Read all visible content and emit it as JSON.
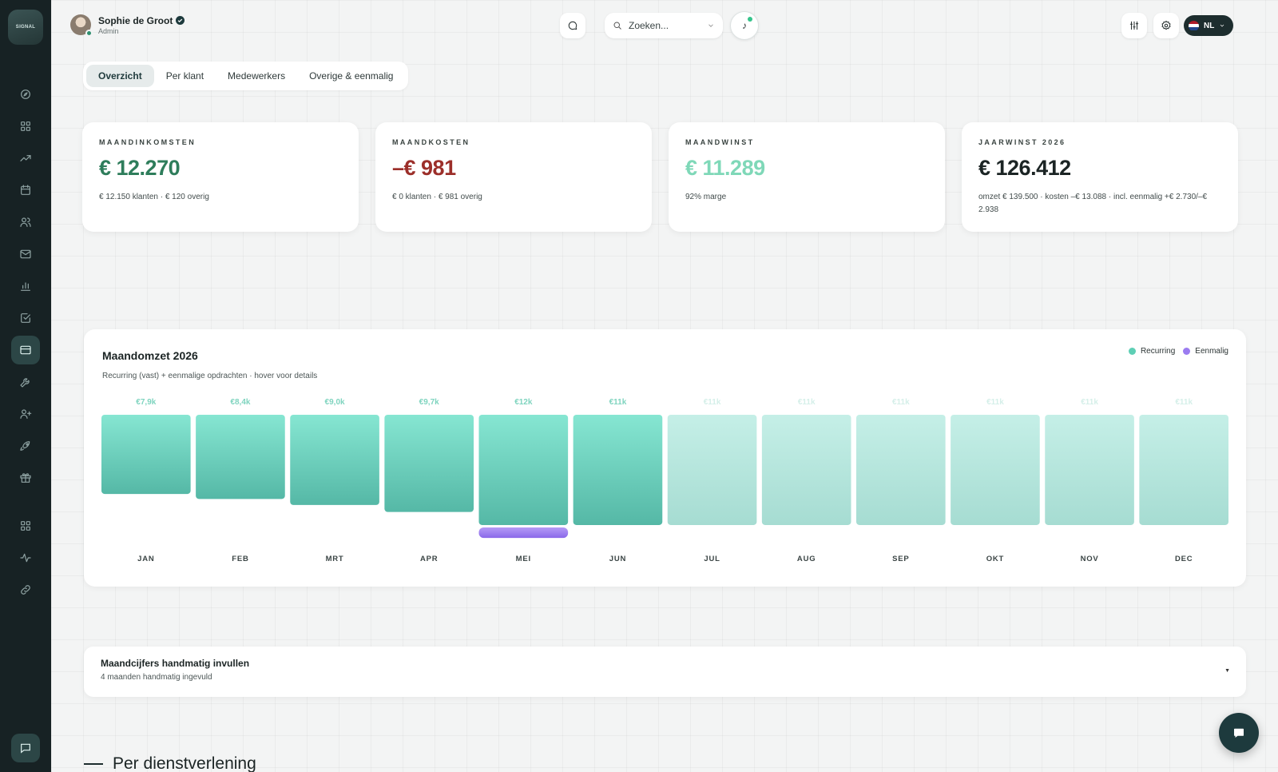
{
  "sidebar": {
    "logo_text": "SIGNAL",
    "items": [
      {
        "icon": "compass-icon",
        "name": "sidebar-item-explore"
      },
      {
        "icon": "grid-icon",
        "name": "sidebar-item-dashboard"
      },
      {
        "icon": "trending-up-icon",
        "name": "sidebar-item-trends"
      },
      {
        "icon": "calendar-icon",
        "name": "sidebar-item-calendar"
      },
      {
        "icon": "users-icon",
        "name": "sidebar-item-team"
      },
      {
        "icon": "mail-icon",
        "name": "sidebar-item-mail"
      },
      {
        "icon": "bar-chart-icon",
        "name": "sidebar-item-reports"
      },
      {
        "icon": "checkbox-icon",
        "name": "sidebar-item-tasks"
      },
      {
        "icon": "credit-card-icon",
        "name": "sidebar-item-finance",
        "active": true
      },
      {
        "icon": "wrench-icon",
        "name": "sidebar-item-tools"
      },
      {
        "icon": "user-plus-icon",
        "name": "sidebar-item-add-user"
      },
      {
        "icon": "rocket-icon",
        "name": "sidebar-item-launch"
      },
      {
        "icon": "gift-icon",
        "name": "sidebar-item-gifts"
      }
    ],
    "items_bottom": [
      {
        "icon": "apps-icon",
        "name": "sidebar-item-apps"
      },
      {
        "icon": "activity-icon",
        "name": "sidebar-item-activity"
      },
      {
        "icon": "link-icon",
        "name": "sidebar-item-links"
      }
    ]
  },
  "header": {
    "user_name": "Sophie de Groot",
    "user_role": "Admin",
    "search_placeholder": "Zoeken...",
    "language": "NL"
  },
  "tabs": [
    {
      "label": "Overzicht",
      "active": true
    },
    {
      "label": "Per klant",
      "active": false
    },
    {
      "label": "Medewerkers",
      "active": false
    },
    {
      "label": "Overige & eenmalig",
      "active": false
    }
  ],
  "cards": [
    {
      "label": "MAANDINKOMSTEN",
      "value": "€ 12.270",
      "sub": "€ 12.150 klanten · € 120 overig",
      "color": "#2e7d5b"
    },
    {
      "label": "MAANDKOSTEN",
      "value": "–€ 981",
      "sub": "€ 0 klanten · € 981 overig",
      "color": "#9c2f2a"
    },
    {
      "label": "MAANDWINST",
      "value": "€ 11.289",
      "sub": "92% marge",
      "color": "#7fd8b8"
    },
    {
      "label": "JAARWINST 2026",
      "value": "€ 126.412",
      "sub": "omzet € 139.500 · kosten –€ 13.088 · incl. eenmalig +€ 2.730/–€ 2.938",
      "color": "#1b2424"
    }
  ],
  "chart": {
    "title": "Maandomzet 2026",
    "subtitle": "Recurring (vast) + eenmalige opdrachten · hover voor details",
    "legend": [
      {
        "label": "Recurring",
        "color": "#5ecfb5"
      },
      {
        "label": "Eenmalig",
        "color": "#9b7cf0"
      }
    ]
  },
  "chart_data": {
    "type": "bar",
    "categories": [
      "JAN",
      "FEB",
      "MRT",
      "APR",
      "MEI",
      "JUN",
      "JUL",
      "AUG",
      "SEP",
      "OKT",
      "NOV",
      "DEC"
    ],
    "series": [
      {
        "name": "Recurring",
        "values": [
          7.9,
          8.4,
          9.0,
          9.7,
          11.0,
          11.0,
          11.0,
          11.0,
          11.0,
          11.0,
          11.0,
          11.0
        ]
      },
      {
        "name": "Eenmalig",
        "values": [
          0,
          0,
          0,
          0,
          1.0,
          0,
          0,
          0,
          0,
          0,
          0,
          0
        ]
      }
    ],
    "data_labels": [
      "€7,9k",
      "€8,4k",
      "€9,0k",
      "€9,7k",
      "€12k",
      "€11k",
      "€11k",
      "€11k",
      "€11k",
      "€11k",
      "€11k",
      "€11k"
    ],
    "projected_from_index": 6,
    "ylim": [
      0,
      12
    ],
    "unit": "k€",
    "legend_position": "top-right",
    "grid": false
  },
  "manual": {
    "title": "Maandcijfers handmatig invullen",
    "subtitle": "4 maanden handmatig ingevuld",
    "caret": "▼"
  },
  "section": {
    "title": "Per dienstverlening"
  }
}
